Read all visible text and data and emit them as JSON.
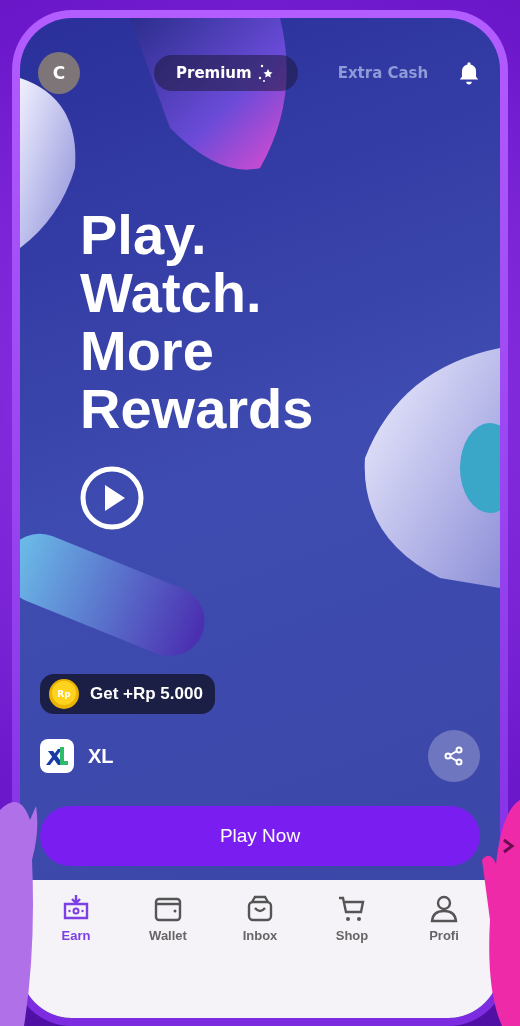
{
  "top_bar": {
    "avatar": "C",
    "tabs": [
      {
        "label": "Premium",
        "selected": true
      },
      {
        "label": "Extra Cash",
        "selected": false
      }
    ]
  },
  "hero": {
    "headline": [
      "Play.",
      "Watch.",
      "More",
      "Rewards"
    ]
  },
  "reward": {
    "label": "Get +Rp 5.000",
    "coin": "Rp"
  },
  "brand": {
    "name": "XL"
  },
  "play_button": {
    "label": "Play Now"
  },
  "nav": [
    {
      "label": "Earn",
      "selected": true
    },
    {
      "label": "Wallet",
      "selected": false
    },
    {
      "label": "Inbox",
      "selected": false
    },
    {
      "label": "Shop",
      "selected": false
    },
    {
      "label": "Profi",
      "selected": false
    }
  ]
}
